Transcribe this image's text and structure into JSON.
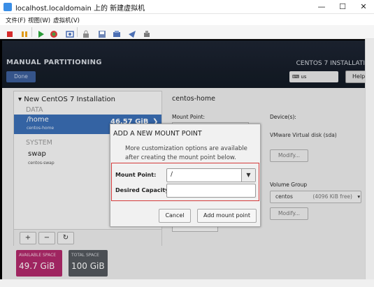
{
  "window": {
    "title": "localhost.localdomain 上的 新建虚拟机",
    "minimize": "—",
    "maximize": "☐",
    "close": "✕"
  },
  "menu": [
    "文件(F)",
    "视图(W)",
    "虚拟机(V)"
  ],
  "toolbar_icons": [
    "stop-icon",
    "pause-icon",
    "play-icon",
    "refresh-icon",
    "snapshot-icon",
    "lock-icon",
    "disk-icon",
    "restore-icon",
    "send-icon",
    "settings-icon"
  ],
  "installer": {
    "page_title": "MANUAL PARTITIONING",
    "done_button": "Done",
    "product_title": "CENTOS 7 INSTALLATI",
    "keyboard": "us",
    "help_button": "Help",
    "tree_header": "New CentOS 7 Installation",
    "section_data": "DATA",
    "home": {
      "name": "/home",
      "sub": "centos-home",
      "size": "46.57 GiB"
    },
    "section_system": "SYSTEM",
    "swap": {
      "name": "swap",
      "sub": "centos-swap"
    },
    "buttons": [
      "+",
      "−",
      "↻"
    ],
    "available_label": "AVAILABLE SPACE",
    "available_value": "49.7 GiB",
    "total_label": "TOTAL SPACE",
    "total_value": "100 GiB",
    "detail_title": "centos-home",
    "mount_point_label": "Mount Point:",
    "devices_label": "Device(s):",
    "device_value": "VMware Virtual disk (sda)",
    "modify_button": "Modify...",
    "volume_group_label": "Volume Group",
    "volume_group_value": "centos",
    "volume_group_free": "(4096 KiB free)",
    "modify_button2": "Modify..."
  },
  "dialog": {
    "title": "ADD A NEW MOUNT POINT",
    "desc_line1": "More customization options are available",
    "desc_line2": "after creating the mount point below.",
    "mount_point_label": "Mount Point:",
    "mount_point_value": "/",
    "capacity_label": "Desired Capacity:",
    "capacity_value": "",
    "cancel_button": "Cancel",
    "add_button": "Add mount point"
  },
  "colors": {
    "selection": "#3a6fb6",
    "available_bg": "#b12a6b",
    "total_bg": "#54585e",
    "highlight": "#d33a3a"
  }
}
